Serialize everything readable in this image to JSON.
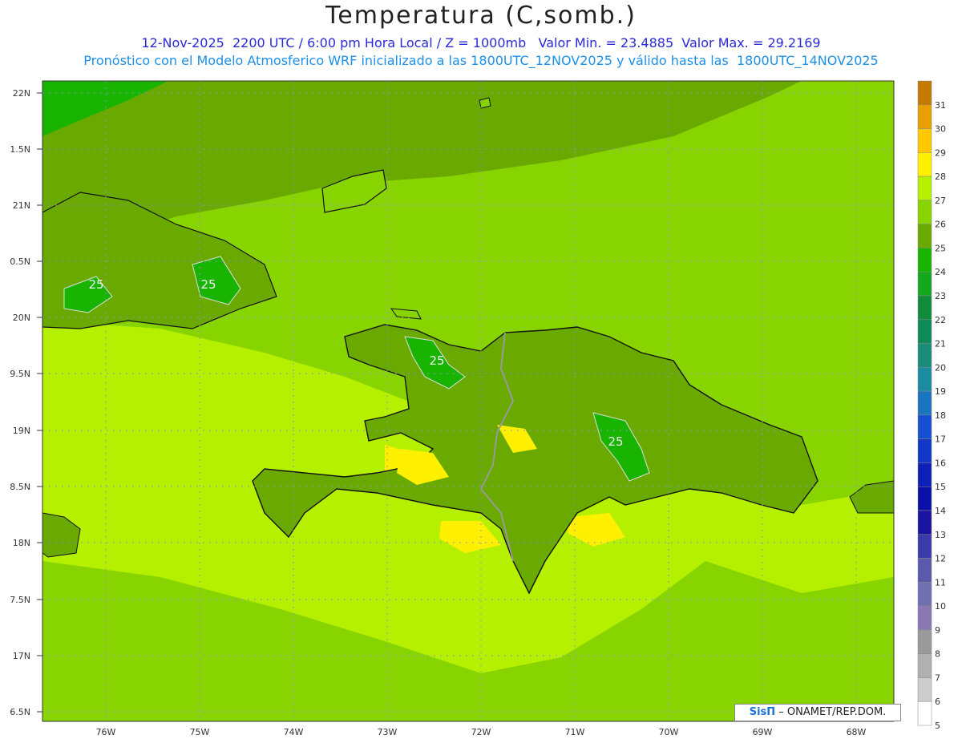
{
  "title": "Temperatura (C,somb.)",
  "subtitle_line1": "12-Nov-2025  2200 UTC / 6:00 pm Hora Local / Z = 1000mb   Valor Min. = 23.4885  Valor Max. = 29.2169",
  "subtitle_line2": "Pronóstico con el Modelo Atmosferico WRF inicializado a las 1800UTC_12NOV2025 y válido hasta las  1800UTC_14NOV2025",
  "lat_labels": [
    "22N",
    "1.5N",
    "21N",
    "0.5N",
    "20N",
    "9.5N",
    "19N",
    "8.5N",
    "18N",
    "7.5N",
    "17N",
    "6.5N"
  ],
  "lon_labels": [
    "76W",
    "75W",
    "74W",
    "73W",
    "72W",
    "71W",
    "70W",
    "69W",
    "68W"
  ],
  "contour_labels": [
    "25",
    "25",
    "25",
    "25"
  ],
  "colorbar": {
    "labels": [
      "31",
      "30",
      "29",
      "28",
      "27",
      "26",
      "25",
      "24",
      "23",
      "22",
      "21",
      "20",
      "19",
      "18",
      "17",
      "16",
      "15",
      "14",
      "13",
      "12",
      "11",
      "10",
      "9",
      "8",
      "7",
      "6",
      "5"
    ],
    "colors": [
      "#c47a00",
      "#e8a000",
      "#ffc800",
      "#fff000",
      "#b4f000",
      "#88d400",
      "#6aaa00",
      "#18b400",
      "#14a81e",
      "#128c3c",
      "#0f8a5a",
      "#1a8c78",
      "#1c8ca0",
      "#1a74c0",
      "#1650d0",
      "#1238c8",
      "#0c20b8",
      "#0a10a8",
      "#1a14a0",
      "#3a3aa8",
      "#5a5aac",
      "#7070b0",
      "#8a78b4",
      "#9a9a9a",
      "#b0b0b0",
      "#cccccc",
      "#ffffff"
    ]
  },
  "credit": {
    "brand": "SisΠ",
    "text": " – ONAMET/REP.DOM."
  }
}
